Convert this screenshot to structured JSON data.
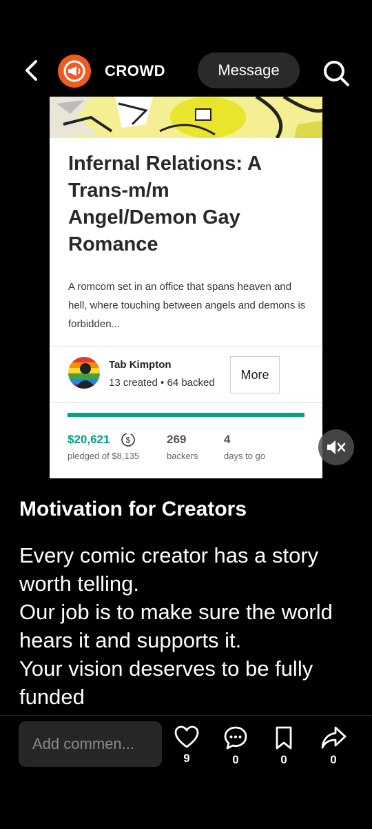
{
  "header": {
    "brand": "CROWD",
    "message_label": "Message"
  },
  "card": {
    "title": "Infernal Relations: A Trans-m/m Angel/Demon Gay Romance",
    "description": "A romcom set in an office that spans heaven and hell, where touching between angels and demons is forbidden...",
    "creator": {
      "name": "Tab Kimpton",
      "stats": "13 created • 64 backed"
    },
    "more_label": "More",
    "progress": 1.0,
    "pledged_amount": "$20,621",
    "pledged_label": "pledged of $8,135",
    "backers_count": "269",
    "backers_label": "backers",
    "days_count": "4",
    "days_label": "days to go"
  },
  "post": {
    "title": "Motivation for Creators",
    "lines": [
      "Every comic creator has a story worth telling.",
      "Our job is to make sure the world hears it  and supports it.",
      "Your vision deserves to be fully funded"
    ]
  },
  "bottom": {
    "comment_placeholder": "Add commen...",
    "likes": "9",
    "comments": "0",
    "saves": "0",
    "shares": "0"
  },
  "colors": {
    "accent_green": "#05a081",
    "brand_orange": "#f15a22"
  },
  "icons": [
    "back-arrow-icon",
    "megaphone-logo-icon",
    "search-icon",
    "currency-icon",
    "mute-icon",
    "heart-icon",
    "comment-icon",
    "bookmark-icon",
    "share-icon"
  ]
}
